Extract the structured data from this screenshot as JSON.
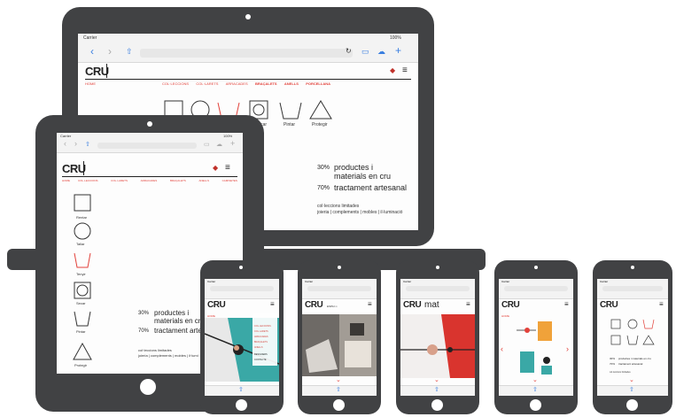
{
  "status": {
    "carrier": "Carrier",
    "battery": "100%"
  },
  "brand": {
    "logo": "CRU",
    "logo_mat": "CRU",
    "mat_suffix": "mat",
    "subtitle": "ESPAI ∞",
    "home_link": "HOME"
  },
  "nav": {
    "laptop": [
      "COL·LECCIONS",
      "COL·LARETS",
      "ARRACADES",
      "BRAÇALETS",
      "ANELLS",
      "PORCELLANA"
    ],
    "tablet": [
      "COL·LECCIONS",
      "COL·LARETS",
      "ARRACADES",
      "BRAÇALETS",
      "ANELLS",
      "CAMISETES"
    ]
  },
  "care": {
    "laptop_labels": [
      "Secar",
      "Pintar",
      "Protegir"
    ],
    "tablet_labels": [
      "Rentar",
      "Tallar",
      "Tenyir",
      "Secar",
      "Pintar",
      "Protegir"
    ]
  },
  "stats": [
    {
      "percent": "30%",
      "text": "productes i materials en cru"
    },
    {
      "percent": "70%",
      "text": "tractament artesanal"
    }
  ],
  "stats_laptop": [
    {
      "percent": "30%",
      "line1": "productes i",
      "line2": "materials en cru"
    },
    {
      "percent": "70%",
      "line1": "tractament artesanal",
      "line2": ""
    }
  ],
  "stats_tablet": [
    {
      "percent": "30%",
      "line1": "productes i",
      "line2": "materials en cru"
    },
    {
      "percent": "70%",
      "line1": "tractament artesa",
      "line2": ""
    }
  ],
  "footer": {
    "title": "col·leccions limitades",
    "laptop_line": "joieria | complements | mobles | il·luminació",
    "tablet_line": "joieria | complements | mobles | il·lumi"
  },
  "phone_menu": [
    "COL·LECCIONS",
    "COL·LARETS",
    "ARRACADES",
    "BRAÇALETS",
    "ANELLS",
    "DESIGNERS",
    "CONTACTE"
  ],
  "colors": {
    "device": "#414244",
    "accent": "#e2413a",
    "teal": "#3aa8a6",
    "orange": "#f0a23a"
  }
}
